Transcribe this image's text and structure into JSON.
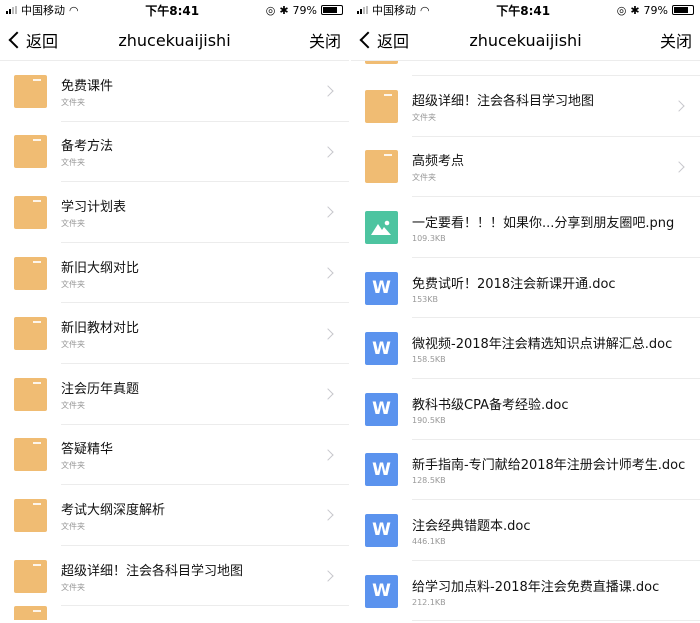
{
  "status": {
    "carrier": "中国移动",
    "time": "下午8:41",
    "battery": "79%"
  },
  "nav": {
    "back": "返回",
    "title": "zhucekuaijishi",
    "close": "关闭"
  },
  "colors": {
    "folder": "#F0BC73",
    "doc": "#5B93EE",
    "image": "#4DC4A0"
  },
  "panels": [
    {
      "items": [
        {
          "type": "folder",
          "name": "免费课件",
          "sub": "文件夹"
        },
        {
          "type": "folder",
          "name": "备考方法",
          "sub": "文件夹"
        },
        {
          "type": "folder",
          "name": "学习计划表",
          "sub": "文件夹"
        },
        {
          "type": "folder",
          "name": "新旧大纲对比",
          "sub": "文件夹"
        },
        {
          "type": "folder",
          "name": "新旧教材对比",
          "sub": "文件夹"
        },
        {
          "type": "folder",
          "name": "注会历年真题",
          "sub": "文件夹"
        },
        {
          "type": "folder",
          "name": "答疑精华",
          "sub": "文件夹"
        },
        {
          "type": "folder",
          "name": "考试大纲深度解析",
          "sub": "文件夹"
        },
        {
          "type": "folder",
          "name": "超级详细！注会各科目学习地图",
          "sub": "文件夹"
        },
        {
          "type": "folder",
          "name": "",
          "sub": ""
        }
      ]
    },
    {
      "items": [
        {
          "type": "folder",
          "name": "",
          "sub": ""
        },
        {
          "type": "folder",
          "name": "超级详细！注会各科目学习地图",
          "sub": "文件夹"
        },
        {
          "type": "folder",
          "name": "高频考点",
          "sub": "文件夹"
        },
        {
          "type": "image",
          "name": "一定要看！！！如果你...分享到朋友圈吧.png",
          "sub": "109.3KB"
        },
        {
          "type": "doc",
          "name": "免费试听！2018注会新课开通.doc",
          "sub": "153KB"
        },
        {
          "type": "doc",
          "name": "微视频-2018年注会精选知识点讲解汇总.doc",
          "sub": "158.5KB"
        },
        {
          "type": "doc",
          "name": "教科书级CPA备考经验.doc",
          "sub": "190.5KB"
        },
        {
          "type": "doc",
          "name": "新手指南-专门献给2018年注册会计师考生.doc",
          "sub": "128.5KB"
        },
        {
          "type": "doc",
          "name": "注会经典错题本.doc",
          "sub": "446.1KB"
        },
        {
          "type": "doc",
          "name": "给学习加点料-2018年注会免费直播课.doc",
          "sub": "212.1KB"
        }
      ]
    }
  ],
  "doc_glyph": "W"
}
